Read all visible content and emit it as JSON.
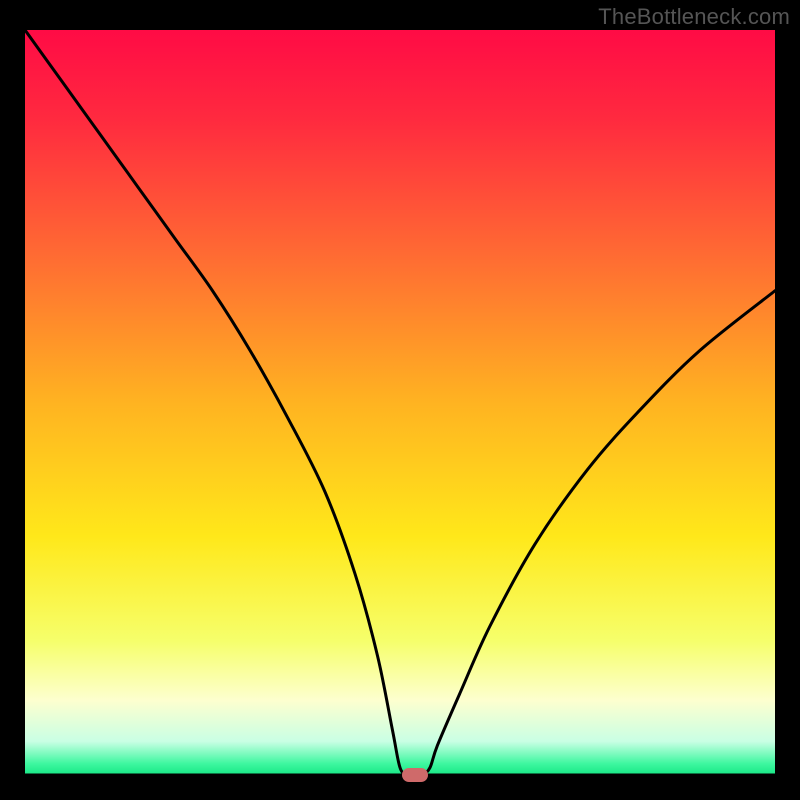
{
  "watermark": "TheBottleneck.com",
  "colors": {
    "axis": "#000000",
    "curve": "#000000",
    "marker": "#cf6a6a",
    "gradient_stops": [
      {
        "offset": 0.0,
        "color": "#ff0b45"
      },
      {
        "offset": 0.12,
        "color": "#ff2a3f"
      },
      {
        "offset": 0.3,
        "color": "#ff6a33"
      },
      {
        "offset": 0.5,
        "color": "#ffb321"
      },
      {
        "offset": 0.68,
        "color": "#ffe81a"
      },
      {
        "offset": 0.82,
        "color": "#f6ff6b"
      },
      {
        "offset": 0.9,
        "color": "#fdffcf"
      },
      {
        "offset": 0.955,
        "color": "#c9ffe4"
      },
      {
        "offset": 0.985,
        "color": "#3df79f"
      },
      {
        "offset": 1.0,
        "color": "#17e785"
      }
    ]
  },
  "chart_data": {
    "type": "line",
    "title": "",
    "xlabel": "",
    "ylabel": "",
    "x": [
      0,
      5,
      10,
      15,
      20,
      25,
      30,
      35,
      40,
      44,
      47,
      49,
      50,
      51,
      52,
      53,
      54,
      55,
      58,
      62,
      68,
      75,
      82,
      90,
      100
    ],
    "values": [
      100,
      93,
      86,
      79,
      72,
      65,
      57,
      48,
      38,
      27,
      16,
      6,
      1,
      0,
      0,
      0,
      1,
      4,
      11,
      20,
      31,
      41,
      49,
      57,
      65
    ],
    "xlim": [
      0,
      100
    ],
    "ylim": [
      0,
      100
    ],
    "minimum_marker": {
      "x": 52,
      "y": 0
    }
  }
}
